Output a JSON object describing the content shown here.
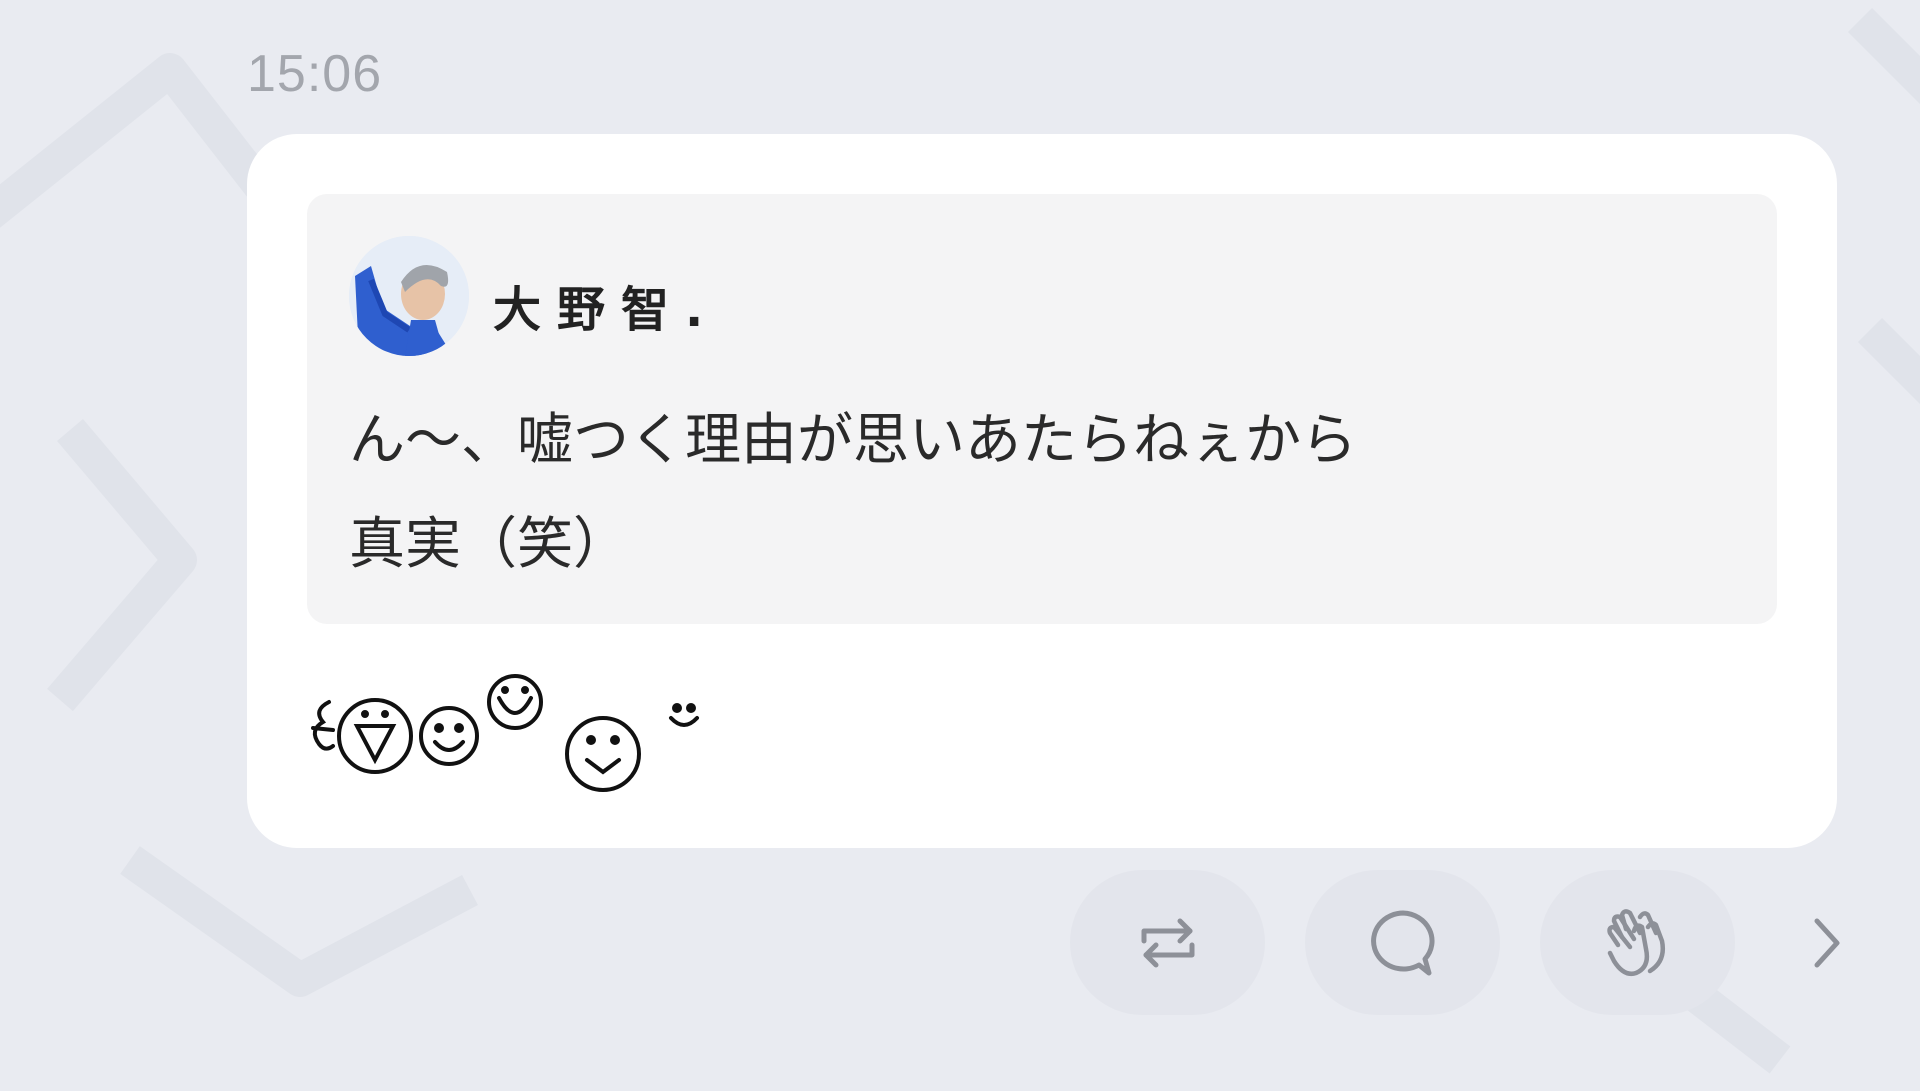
{
  "message": {
    "time": "15:06",
    "quote": {
      "author": "大野智.",
      "lines": [
        "ん〜、嘘つく理由が思いあたらねぇから",
        "真実（笑）"
      ]
    },
    "reaction_emoji": "ξ(▽)☺Ü(⌣)ᵕ̈"
  },
  "actions": [
    {
      "icon": "repost-icon"
    },
    {
      "icon": "comment-icon"
    },
    {
      "icon": "clap-icon"
    },
    {
      "icon": "chevron-right-icon"
    }
  ],
  "colors": {
    "background": "#e9ebf1",
    "card": "#ffffff",
    "quote_box": "#f4f4f5",
    "action_button": "#e3e5ec",
    "icon": "#8d9098",
    "timestamp": "#a3a6ad"
  }
}
